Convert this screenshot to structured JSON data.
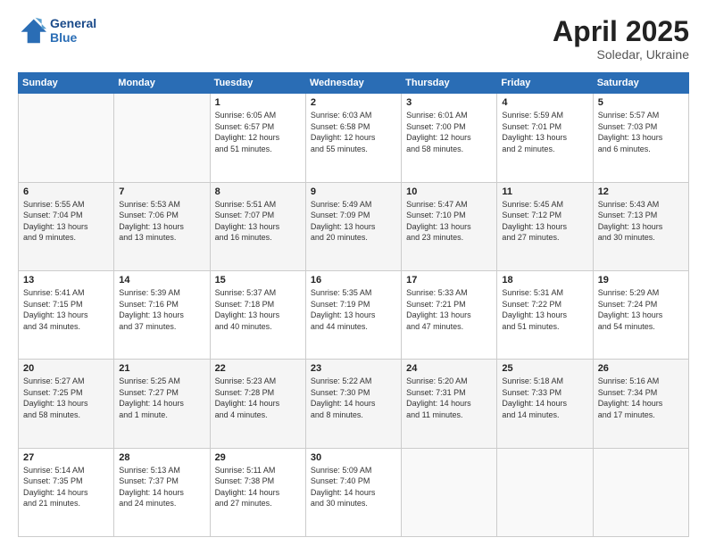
{
  "logo": {
    "line1": "General",
    "line2": "Blue"
  },
  "title": "April 2025",
  "subtitle": "Soledar, Ukraine",
  "days_header": [
    "Sunday",
    "Monday",
    "Tuesday",
    "Wednesday",
    "Thursday",
    "Friday",
    "Saturday"
  ],
  "weeks": [
    [
      {
        "day": "",
        "info": ""
      },
      {
        "day": "",
        "info": ""
      },
      {
        "day": "1",
        "info": "Sunrise: 6:05 AM\nSunset: 6:57 PM\nDaylight: 12 hours\nand 51 minutes."
      },
      {
        "day": "2",
        "info": "Sunrise: 6:03 AM\nSunset: 6:58 PM\nDaylight: 12 hours\nand 55 minutes."
      },
      {
        "day": "3",
        "info": "Sunrise: 6:01 AM\nSunset: 7:00 PM\nDaylight: 12 hours\nand 58 minutes."
      },
      {
        "day": "4",
        "info": "Sunrise: 5:59 AM\nSunset: 7:01 PM\nDaylight: 13 hours\nand 2 minutes."
      },
      {
        "day": "5",
        "info": "Sunrise: 5:57 AM\nSunset: 7:03 PM\nDaylight: 13 hours\nand 6 minutes."
      }
    ],
    [
      {
        "day": "6",
        "info": "Sunrise: 5:55 AM\nSunset: 7:04 PM\nDaylight: 13 hours\nand 9 minutes."
      },
      {
        "day": "7",
        "info": "Sunrise: 5:53 AM\nSunset: 7:06 PM\nDaylight: 13 hours\nand 13 minutes."
      },
      {
        "day": "8",
        "info": "Sunrise: 5:51 AM\nSunset: 7:07 PM\nDaylight: 13 hours\nand 16 minutes."
      },
      {
        "day": "9",
        "info": "Sunrise: 5:49 AM\nSunset: 7:09 PM\nDaylight: 13 hours\nand 20 minutes."
      },
      {
        "day": "10",
        "info": "Sunrise: 5:47 AM\nSunset: 7:10 PM\nDaylight: 13 hours\nand 23 minutes."
      },
      {
        "day": "11",
        "info": "Sunrise: 5:45 AM\nSunset: 7:12 PM\nDaylight: 13 hours\nand 27 minutes."
      },
      {
        "day": "12",
        "info": "Sunrise: 5:43 AM\nSunset: 7:13 PM\nDaylight: 13 hours\nand 30 minutes."
      }
    ],
    [
      {
        "day": "13",
        "info": "Sunrise: 5:41 AM\nSunset: 7:15 PM\nDaylight: 13 hours\nand 34 minutes."
      },
      {
        "day": "14",
        "info": "Sunrise: 5:39 AM\nSunset: 7:16 PM\nDaylight: 13 hours\nand 37 minutes."
      },
      {
        "day": "15",
        "info": "Sunrise: 5:37 AM\nSunset: 7:18 PM\nDaylight: 13 hours\nand 40 minutes."
      },
      {
        "day": "16",
        "info": "Sunrise: 5:35 AM\nSunset: 7:19 PM\nDaylight: 13 hours\nand 44 minutes."
      },
      {
        "day": "17",
        "info": "Sunrise: 5:33 AM\nSunset: 7:21 PM\nDaylight: 13 hours\nand 47 minutes."
      },
      {
        "day": "18",
        "info": "Sunrise: 5:31 AM\nSunset: 7:22 PM\nDaylight: 13 hours\nand 51 minutes."
      },
      {
        "day": "19",
        "info": "Sunrise: 5:29 AM\nSunset: 7:24 PM\nDaylight: 13 hours\nand 54 minutes."
      }
    ],
    [
      {
        "day": "20",
        "info": "Sunrise: 5:27 AM\nSunset: 7:25 PM\nDaylight: 13 hours\nand 58 minutes."
      },
      {
        "day": "21",
        "info": "Sunrise: 5:25 AM\nSunset: 7:27 PM\nDaylight: 14 hours\nand 1 minute."
      },
      {
        "day": "22",
        "info": "Sunrise: 5:23 AM\nSunset: 7:28 PM\nDaylight: 14 hours\nand 4 minutes."
      },
      {
        "day": "23",
        "info": "Sunrise: 5:22 AM\nSunset: 7:30 PM\nDaylight: 14 hours\nand 8 minutes."
      },
      {
        "day": "24",
        "info": "Sunrise: 5:20 AM\nSunset: 7:31 PM\nDaylight: 14 hours\nand 11 minutes."
      },
      {
        "day": "25",
        "info": "Sunrise: 5:18 AM\nSunset: 7:33 PM\nDaylight: 14 hours\nand 14 minutes."
      },
      {
        "day": "26",
        "info": "Sunrise: 5:16 AM\nSunset: 7:34 PM\nDaylight: 14 hours\nand 17 minutes."
      }
    ],
    [
      {
        "day": "27",
        "info": "Sunrise: 5:14 AM\nSunset: 7:35 PM\nDaylight: 14 hours\nand 21 minutes."
      },
      {
        "day": "28",
        "info": "Sunrise: 5:13 AM\nSunset: 7:37 PM\nDaylight: 14 hours\nand 24 minutes."
      },
      {
        "day": "29",
        "info": "Sunrise: 5:11 AM\nSunset: 7:38 PM\nDaylight: 14 hours\nand 27 minutes."
      },
      {
        "day": "30",
        "info": "Sunrise: 5:09 AM\nSunset: 7:40 PM\nDaylight: 14 hours\nand 30 minutes."
      },
      {
        "day": "",
        "info": ""
      },
      {
        "day": "",
        "info": ""
      },
      {
        "day": "",
        "info": ""
      }
    ]
  ]
}
